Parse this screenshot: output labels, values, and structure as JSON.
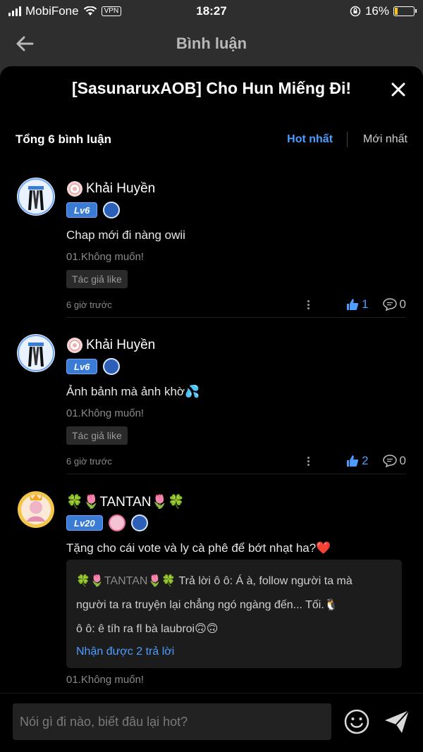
{
  "status": {
    "carrier": "MobiFone",
    "vpn": "VPN",
    "time": "18:27",
    "battery": "16%",
    "battery_level": 0.16
  },
  "header": {
    "title": "Bình luận"
  },
  "sheet": {
    "title": "[SasunaruxAOB] Cho Hun Miếng Đi!",
    "total": "Tổng 6 bình luận",
    "tabs": {
      "hot": "Hot nhất",
      "new": "Mới nhất"
    }
  },
  "comments": [
    {
      "name": "Khải Huyền",
      "level": "Lv6",
      "text": "Chap mới đi nàng owii",
      "chapter": "01.Không muốn!",
      "author_like": "Tác giả like",
      "time": "6 giờ trước",
      "likes": "1",
      "replies": "0"
    },
    {
      "name": "Khải Huyền",
      "level": "Lv6",
      "text": "Ảnh bảnh mà ảnh khờ💦",
      "chapter": "01.Không muốn!",
      "author_like": "Tác giả like",
      "time": "6 giờ trước",
      "likes": "2",
      "replies": "0"
    },
    {
      "name": "🍀🌷TANTAN🌷🍀",
      "level": "Lv20",
      "text": "Tặng cho cái vote và ly cà phê để bớt nhạt ha?❤️",
      "reply_thread": {
        "line1_who": "🍀🌷TANTAN🌷🍀",
        "line1_text": " Trả lời ô ô: Á à, follow người ta mà",
        "line2_text": "người ta ra truyện lại chẳng ngó ngàng đến... Tối.🐧",
        "line3_text": "ô ô: ê tíh ra fl bà laubroi🙃🙃",
        "more": "Nhận được 2 trả lời"
      },
      "chapter": "01.Không muốn!"
    }
  ],
  "composer": {
    "placeholder": "Nói gì đi nào, biết đâu lại hot?"
  }
}
